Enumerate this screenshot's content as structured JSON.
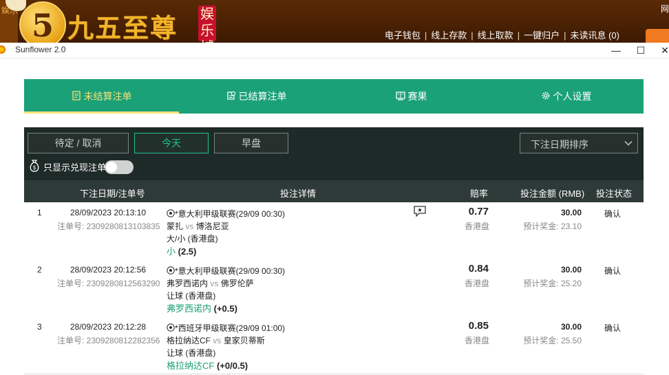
{
  "banner": {
    "logo_char": "5",
    "brand_name": "九五至尊",
    "brand_tag": "娱乐城",
    "left_glyphs": "娱乐",
    "nav": [
      "电子钱包",
      "线上存款",
      "线上取款",
      "一键归户",
      "未读讯息 (0)"
    ],
    "nav_sep": "|",
    "top_right": "网"
  },
  "window": {
    "title": "Sunflower 2.0",
    "minimize": "—",
    "maximize": "☐",
    "close": "✕"
  },
  "tabs": [
    {
      "label": "未结算注单",
      "icon": "document-icon",
      "active": true
    },
    {
      "label": "已结算注单",
      "icon": "settled-icon",
      "active": false
    },
    {
      "label": "赛果",
      "icon": "scoreboard-icon",
      "active": false
    },
    {
      "label": "个人设置",
      "icon": "gear-icon",
      "active": false
    }
  ],
  "filters": {
    "pending": "待定 / 取消",
    "today": "今天",
    "early": "早盘",
    "sort": "下注日期排序",
    "cashout_only": "只显示兑现注单"
  },
  "table": {
    "headers": {
      "date": "下注日期/注单号",
      "details": "投注详情",
      "odds": "赔率",
      "stake": "投注金额 (RMB)",
      "status": "投注状态"
    },
    "bet_no_label": "注单号: ",
    "win_label": "预计奖金: ",
    "rows": [
      {
        "index": "1",
        "date": "28/09/2023 20:13:10",
        "bet_no": "2309280813103835",
        "league": "*意大利甲级联赛(29/09 00:30)",
        "home": "蒙扎",
        "vs": "vs",
        "away": "博洛尼亚",
        "market": "大/小 (香港盘)",
        "pick": "小",
        "pick_value": "(2.5)",
        "odds": "0.77",
        "odds_type": "香港盘",
        "stake": "30.00",
        "win": "23.10",
        "status": "确认",
        "has_chat": true
      },
      {
        "index": "2",
        "date": "28/09/2023 20:12:56",
        "bet_no": "2309280812563290",
        "league": "*意大利甲级联赛(29/09 00:30)",
        "home": "弗罗西诺内",
        "vs": "vs",
        "away": "佛罗伦萨",
        "market": "让球 (香港盘)",
        "pick": "弗罗西诺内",
        "pick_value": "(+0.5)",
        "odds": "0.84",
        "odds_type": "香港盘",
        "stake": "30.00",
        "win": "25.20",
        "status": "确认",
        "has_chat": false
      },
      {
        "index": "3",
        "date": "28/09/2023 20:12:28",
        "bet_no": "2309280812282356",
        "league": "*西班牙甲级联赛(29/09 01:00)",
        "home": "格拉纳达CF",
        "vs": "vs",
        "away": "皇家贝蒂斯",
        "market": "让球 (香港盘)",
        "pick": "格拉纳达CF",
        "pick_value": "(+0/0.5)",
        "odds": "0.85",
        "odds_type": "香港盘",
        "stake": "30.00",
        "win": "25.50",
        "status": "确认",
        "has_chat": false
      }
    ]
  }
}
